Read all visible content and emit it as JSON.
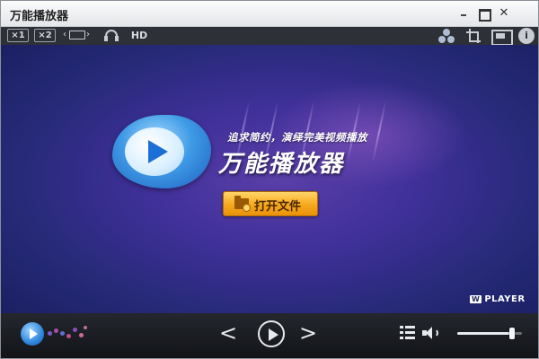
{
  "window": {
    "title": "万能播放器"
  },
  "toolbar": {
    "zoom_1x": "×1",
    "zoom_2x": "×2",
    "hd_label": "HD",
    "info_glyph": "i",
    "icons": [
      "fit-width-icon",
      "headphones-icon",
      "share-icon",
      "crop-icon",
      "fullscreen-icon",
      "info-icon"
    ]
  },
  "splash": {
    "slogan": "追求简约，演绎完美视频播放",
    "brand": "万能播放器",
    "open_button_label": "打开文件",
    "watermark_letter": "W",
    "watermark_text": "PLAYER"
  },
  "controls": {
    "prev_glyph": "<",
    "next_glyph": ">",
    "volume_level": 0.85
  },
  "colors": {
    "accent_button": "#f6a81c",
    "video_background": "#40309a",
    "logo_blue": "#1b6fd6",
    "toolbar_bg": "#2d3036",
    "controls_bg": "#1a1c21"
  }
}
